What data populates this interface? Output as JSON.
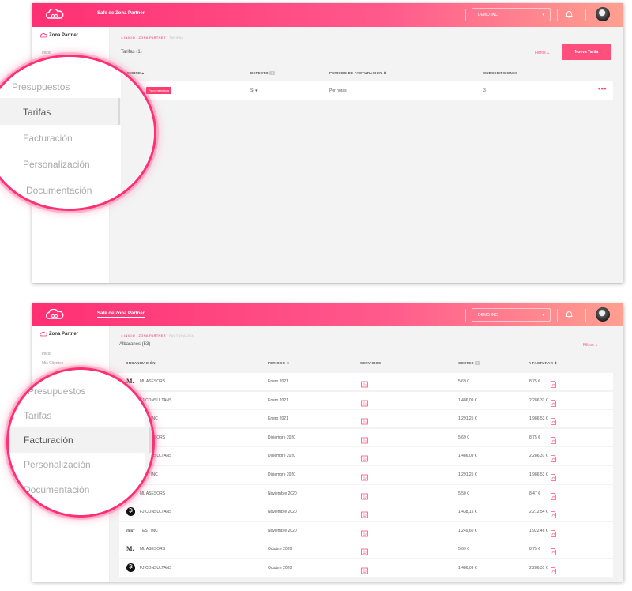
{
  "colors": {
    "accent": "#ff2f74",
    "gradient_end": "#ffa090"
  },
  "screen1": {
    "brand": "Safe de Zona Partner",
    "org_select": "DEMO INC",
    "sidebar": {
      "title": "Zona Partner",
      "items": [
        "Inicio"
      ]
    },
    "breadcrumb": {
      "home": "INICIO",
      "section": "ZONA PARTNER",
      "current": "TARIFAS",
      "sep": "/"
    },
    "page_title": "Tarifas (1)",
    "filters_label": "Filtros",
    "new_button": "Nueva Tarifa",
    "columns": {
      "name": "NOMBRE",
      "default": "DEFECTO",
      "period": "PERIODO DE FACTURACIÓN",
      "subs": "SUBSCRIPCIONES"
    },
    "row": {
      "badge": "Recomendada",
      "default": "Sí",
      "period": "Por horas",
      "subs": "3"
    },
    "magnifier": {
      "items": [
        "Presupuestos",
        "Tarifas",
        "Facturación",
        "Personalización",
        "Documentación"
      ],
      "active": "Tarifas"
    }
  },
  "screen2": {
    "brand": "Safe de Zona Partner",
    "org_select": "DEMO INC",
    "sidebar": {
      "title": "Zona Partner",
      "items": [
        "Inicio",
        "Mis Clientes"
      ]
    },
    "breadcrumb": {
      "home": "INICIO",
      "section": "ZONA PARTNER",
      "current": "FACTURACIÓN",
      "sep": "/"
    },
    "page_title": "Albaranes (53)",
    "filters_label": "Filtros",
    "columns": {
      "org": "ORGANIZACIÓN",
      "period": "PERIODO",
      "services": "SERVICIOS",
      "costs": "COSTES",
      "invoice": "A FACTURAR"
    },
    "rows": [
      {
        "logo": "ml",
        "org": "ML ASESORS",
        "period": "Enero 2021",
        "cost": "5,69 €",
        "invoice": "8,75 €"
      },
      {
        "logo": "fj",
        "org": "FJ CONSULTANS",
        "period": "Enero 2021",
        "cost": "1.486,09 €",
        "invoice": "2.286,31 €"
      },
      {
        "logo": "test",
        "org": "TEST INC",
        "period": "Enero 2021",
        "cost": "1.291,25 €",
        "invoice": "1.986,53 €"
      },
      {
        "logo": "ml",
        "org": "ML ASESORS",
        "period": "Diciembre 2020",
        "cost": "5,69 €",
        "invoice": "8,75 €"
      },
      {
        "logo": "fj",
        "org": "FJ CONSULTANS",
        "period": "Diciembre 2020",
        "cost": "1.486,09 €",
        "invoice": "2.286,31 €"
      },
      {
        "logo": "test",
        "org": "TEST INC",
        "period": "Diciembre 2020",
        "cost": "1.291,25 €",
        "invoice": "1.986,53 €"
      },
      {
        "logo": "ml",
        "org": "ML ASESORS",
        "period": "Noviembre 2020",
        "cost": "5,50 €",
        "invoice": "8,47 €"
      },
      {
        "logo": "fj",
        "org": "FJ CONSULTANS",
        "period": "Noviembre 2020",
        "cost": "1.438,15 €",
        "invoice": "2.212,54 €"
      },
      {
        "logo": "test",
        "org": "TEST INC",
        "period": "Noviembre 2020",
        "cost": "1.249,60 €",
        "invoice": "1.922,46 €"
      },
      {
        "logo": "ml",
        "org": "ML ASESORS",
        "period": "Octubre 2020",
        "cost": "5,69 €",
        "invoice": "8,75 €"
      },
      {
        "logo": "fj",
        "org": "FJ CONSULTANS",
        "period": "Octubre 2020",
        "cost": "1.486,09 €",
        "invoice": "2.286,31 €"
      }
    ],
    "magnifier": {
      "items": [
        "Presupuestos",
        "Tarifas",
        "Facturación",
        "Personalización",
        "Documentación"
      ],
      "active": "Facturación"
    }
  }
}
